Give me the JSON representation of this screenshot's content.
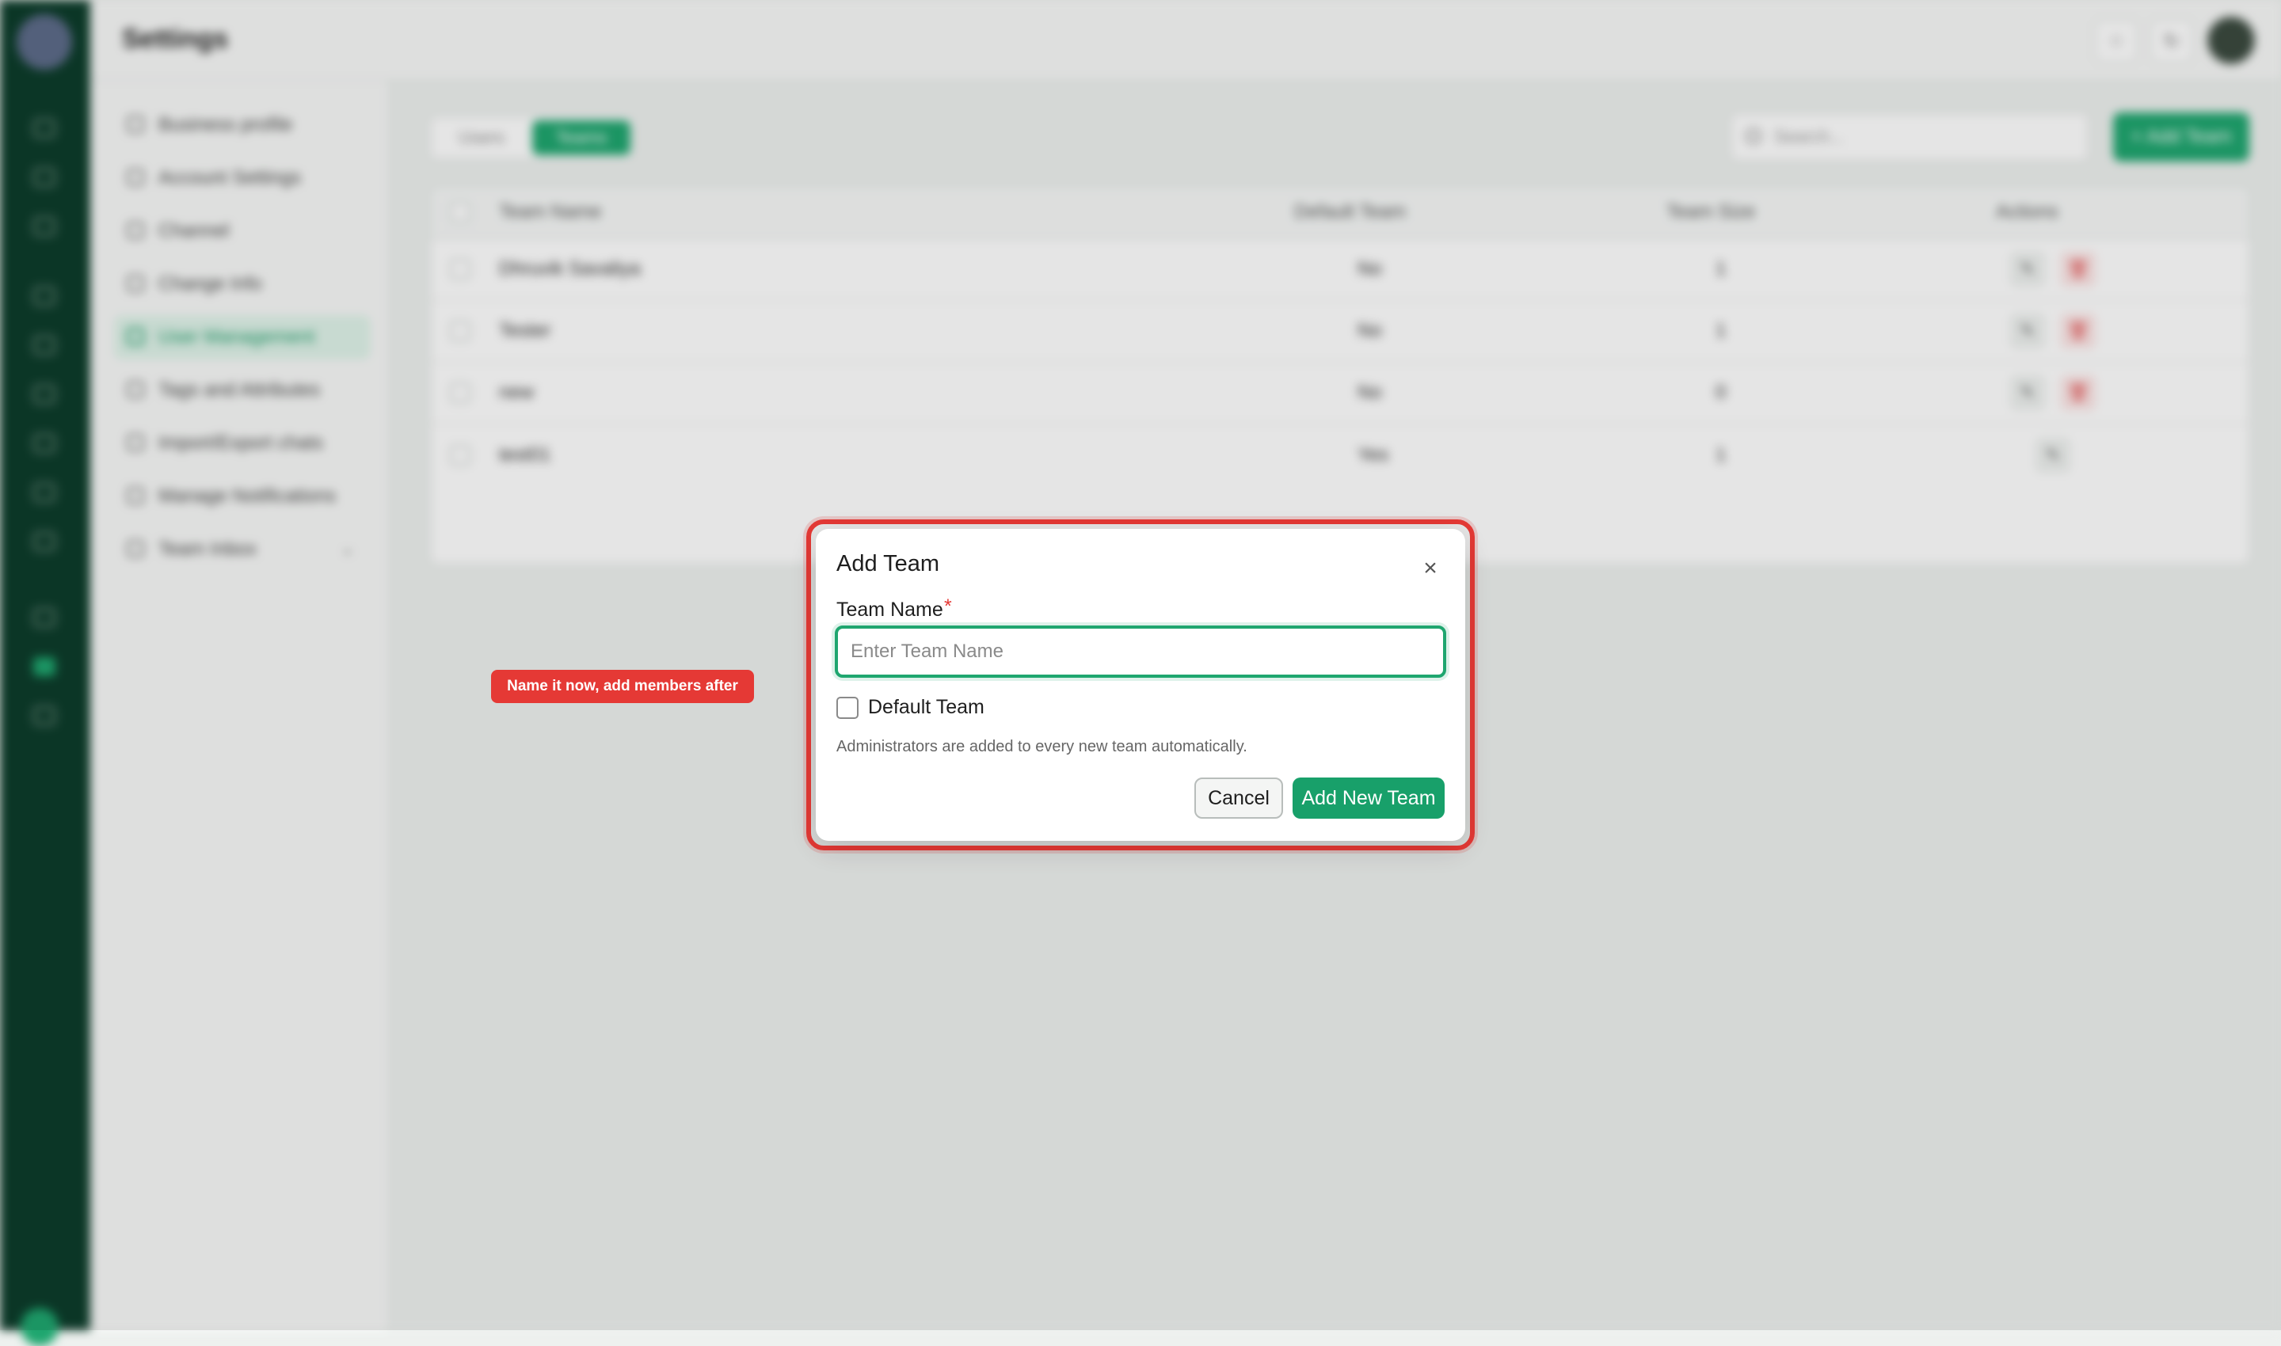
{
  "topbar": {
    "title": "Settings"
  },
  "sidebar": {
    "items": [
      {
        "label": "Business profile"
      },
      {
        "label": "Account Settings"
      },
      {
        "label": "Channel"
      },
      {
        "label": "Change Info"
      },
      {
        "label": "User Management"
      },
      {
        "label": "Tags and Attributes"
      },
      {
        "label": "Import/Export chats"
      },
      {
        "label": "Manage Notifications"
      },
      {
        "label": "Team Inbox"
      }
    ]
  },
  "main": {
    "tabs": [
      {
        "label": "Users"
      },
      {
        "label": "Teams"
      }
    ],
    "search_placeholder": "Search...",
    "add_button": "+ Add Team",
    "table": {
      "headers": [
        "Team Name",
        "Default Team",
        "Team Size",
        "Actions"
      ],
      "rows": [
        {
          "name": "Dhruvik Savaliya",
          "default": "No",
          "size": "1"
        },
        {
          "name": "Tester",
          "default": "No",
          "size": "1"
        },
        {
          "name": "new",
          "default": "No",
          "size": "0"
        },
        {
          "name": "test01",
          "default": "Yes",
          "size": "1"
        }
      ]
    }
  },
  "modal": {
    "title": "Add Team",
    "close_glyph": "×",
    "field_label": "Team Name",
    "required_mark": "*",
    "field_placeholder": "Enter Team Name",
    "field_value": "",
    "checkbox_label": "Default Team",
    "note": "Administrators are added to every new team automatically.",
    "cancel_label": "Cancel",
    "submit_label": "Add New Team"
  },
  "tooltip": {
    "text": "Name it now, add members after"
  },
  "colors": {
    "brand": "#18a06a",
    "highlight": "#e53935",
    "rail": "#0d3d2b"
  }
}
